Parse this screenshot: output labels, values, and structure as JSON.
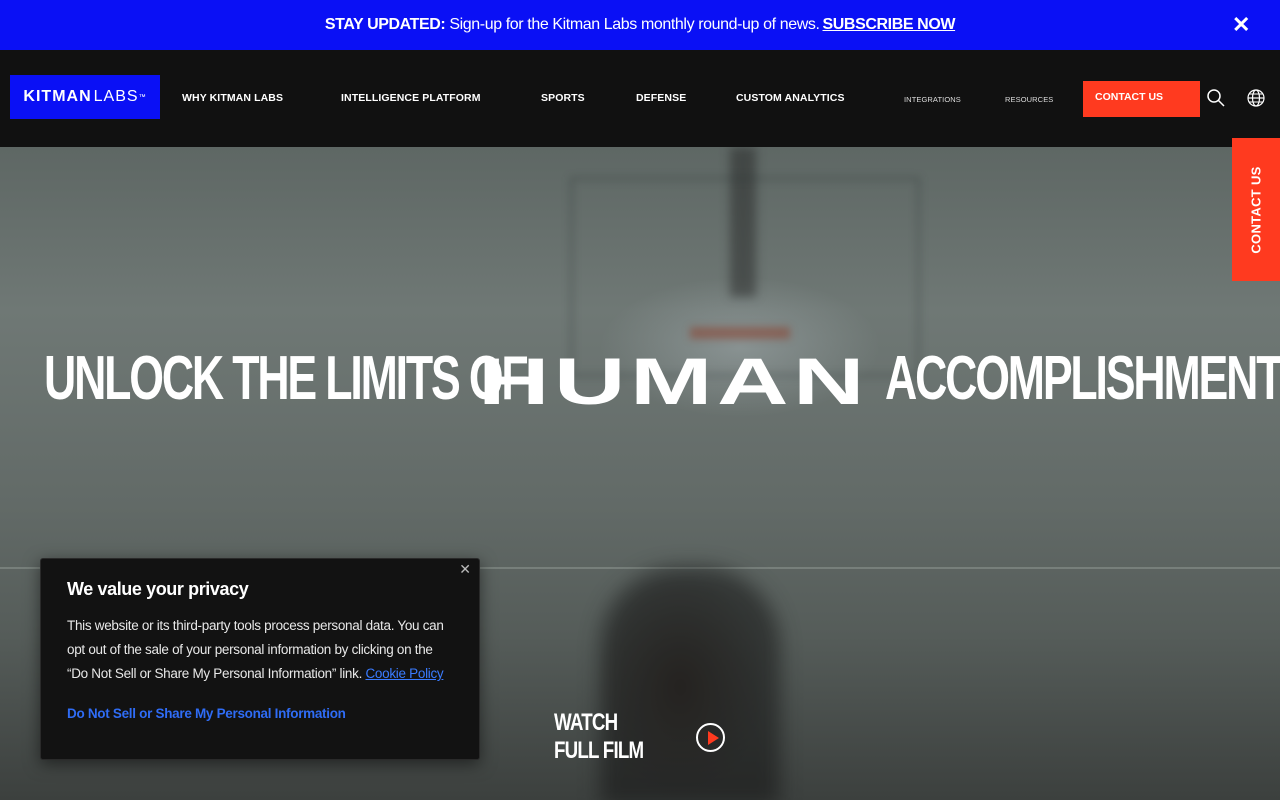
{
  "promo": {
    "lead": "STAY UPDATED:",
    "text": "Sign-up for the Kitman Labs monthly round-up of news.",
    "link": "SUBSCRIBE NOW",
    "close_icon": "close-icon"
  },
  "logo": {
    "bold": "KITMAN",
    "light": "LABS",
    "tm": "™"
  },
  "nav": {
    "items": [
      {
        "label": "WHY KITMAN LABS"
      },
      {
        "label": "INTELLIGENCE PLATFORM"
      },
      {
        "label": "SPORTS"
      },
      {
        "label": "DEFENSE"
      },
      {
        "label": "CUSTOM ANALYTICS"
      },
      {
        "label": "INTEGRATIONS"
      },
      {
        "label": "RESOURCES"
      }
    ],
    "cta": "CONTACT US",
    "search_icon": "search-icon",
    "globe_icon": "globe-icon"
  },
  "hero": {
    "headline_part1": "UNLOCK THE LIMITS OF",
    "headline_emphasis": "HUMAN",
    "headline_part2": "ACCOMPLISHMENT",
    "watch_label": "WATCH FULL FILM",
    "play_icon": "play-icon"
  },
  "side_contact": {
    "label": "CONTACT US"
  },
  "cookie": {
    "title": "We value your privacy",
    "body": "This website or its third-party tools process personal data. You can opt out of the sale of your personal information by clicking on the “Do Not Sell or Share My Personal Information” link.",
    "policy_link": "Cookie Policy",
    "dns_link": "Do Not Sell or Share My Personal Information",
    "close_icon": "close-icon"
  },
  "colors": {
    "brand_blue": "#0a10f5",
    "accent_red": "#ff3a1f",
    "nav_bg": "#111111"
  }
}
